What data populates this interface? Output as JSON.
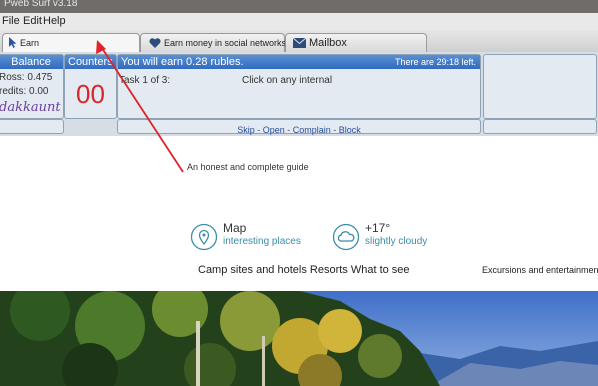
{
  "window": {
    "title": "Pweb Surf v3.18"
  },
  "menu": {
    "items": [
      "File",
      "Edit",
      "Help"
    ]
  },
  "tabs": [
    {
      "label": "Earn",
      "icon": "cursor-icon"
    },
    {
      "label": "Earn money in social networks",
      "icon": "heart-icon"
    },
    {
      "label": "Mailbox",
      "icon": "envelope-icon"
    }
  ],
  "balance": {
    "header": "Balance",
    "ross": "Ross: 0.475",
    "credits": "redits: 0.00",
    "account": "dakkaunt"
  },
  "counters": {
    "header": "Counters",
    "value": "00"
  },
  "task": {
    "header": "You will earn 0.28 rubles.",
    "time_left": "There are 29:18 left.",
    "counter": "Task 1 of 3:",
    "instruction": "Click on any internal",
    "actions": "Skip - Open - Complain - Block"
  },
  "page": {
    "guide": "An honest and complete guide",
    "map_title": "Map",
    "map_sub": "interesting places",
    "weather_title": "+17°",
    "weather_sub": "slightly cloudy",
    "nav": "Camp sites and hotels Resorts What to see",
    "nav_right": "Excursions and entertainment"
  },
  "colors": {
    "accent_blue": "#2f6bc0",
    "counter_red": "#d8262a",
    "account_purple": "#6a3fa0",
    "arrow_red": "#e0222a",
    "icon_teal": "#3a8ea8"
  }
}
